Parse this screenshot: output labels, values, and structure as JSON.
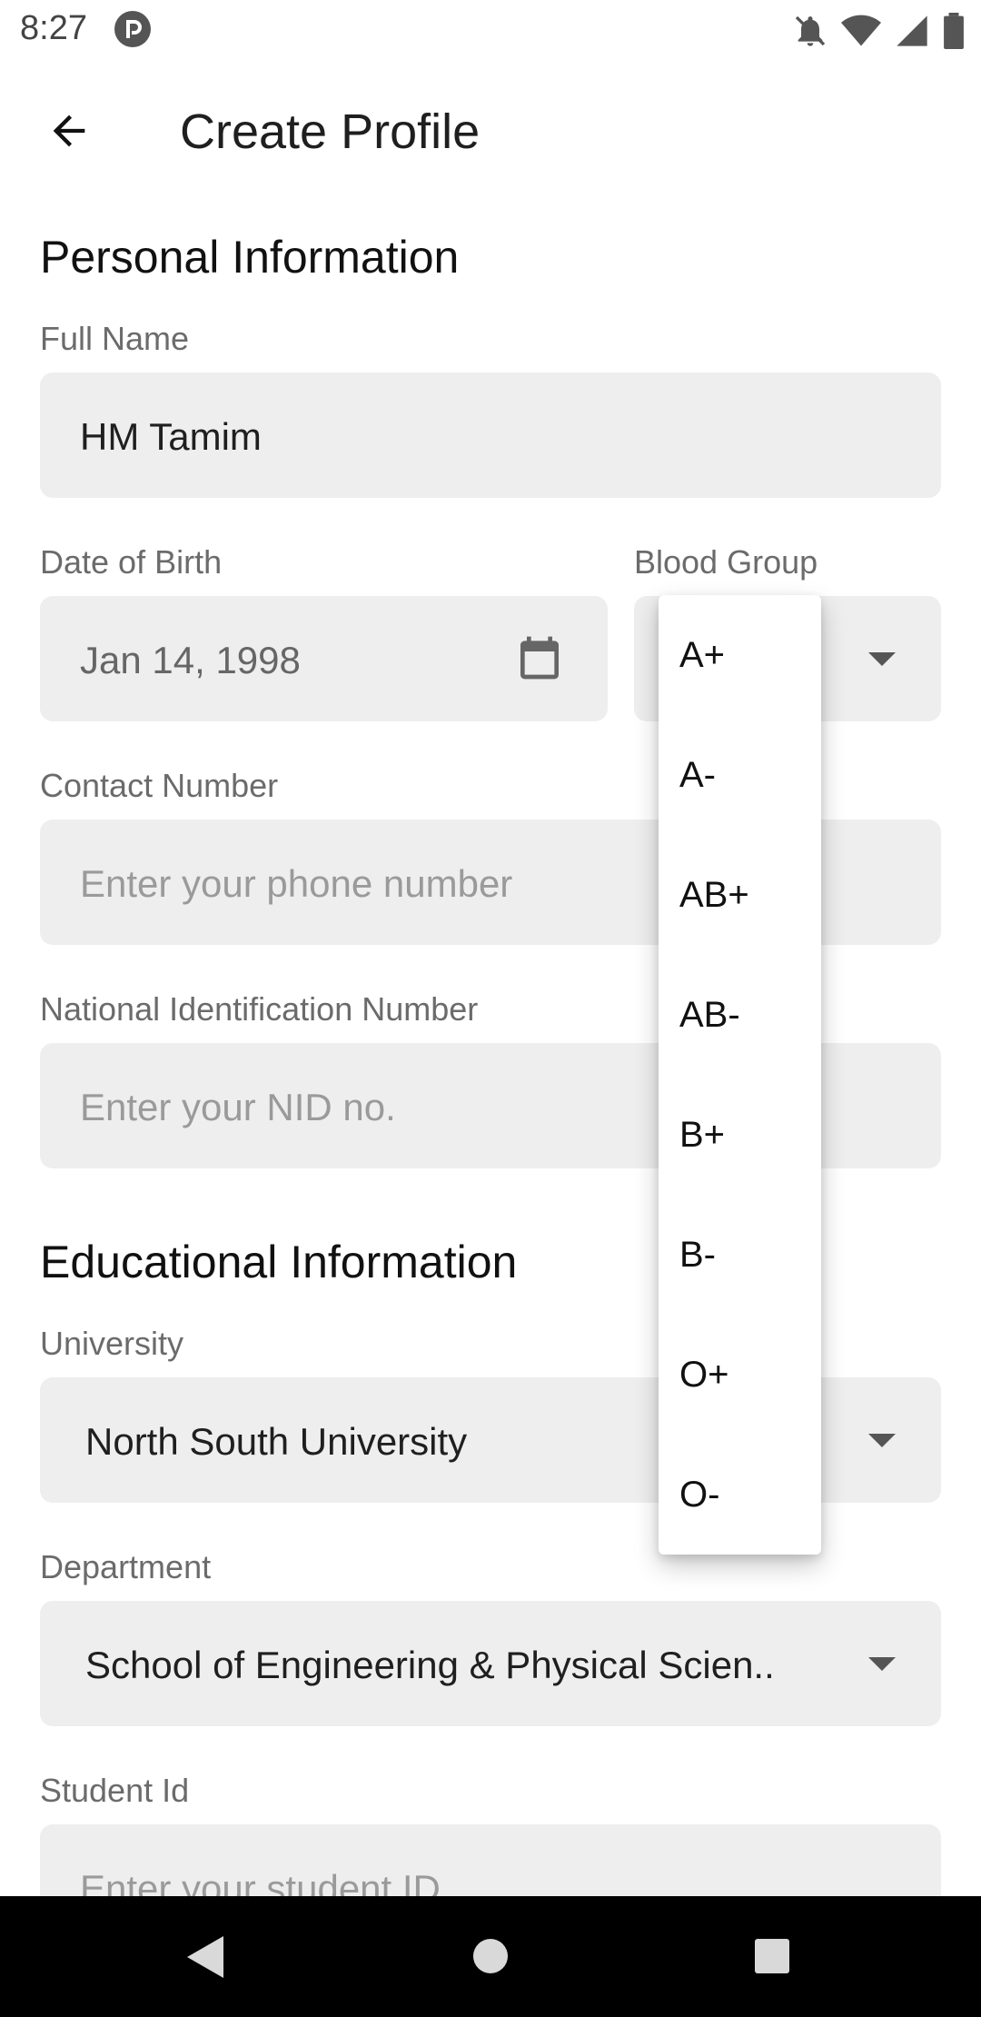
{
  "status_bar": {
    "time": "8:27",
    "icons": [
      "app-icon",
      "notifications-off-icon",
      "wifi-icon",
      "signal-icon",
      "battery-icon"
    ]
  },
  "app_bar": {
    "title": "Create Profile",
    "back_icon": "arrow-back-icon"
  },
  "personal": {
    "title": "Personal Information",
    "full_name": {
      "label": "Full Name",
      "value": "HM Tamim"
    },
    "dob": {
      "label": "Date of Birth",
      "value": "Jan 14, 1998",
      "icon": "calendar-icon"
    },
    "blood_group": {
      "label": "Blood Group",
      "value": ""
    },
    "contact": {
      "label": "Contact Number",
      "placeholder": "Enter your phone number"
    },
    "nid": {
      "label": "National Identification Number",
      "placeholder": "Enter your NID no."
    }
  },
  "education": {
    "title": "Educational Information",
    "university": {
      "label": "University",
      "value": "North South University"
    },
    "department": {
      "label": "Department",
      "value": "School of Engineering & Physical Scien.."
    },
    "student_id": {
      "label": "Student Id",
      "placeholder": "Enter your student ID"
    }
  },
  "blood_menu": {
    "options": [
      "A+",
      "A-",
      "AB+",
      "AB-",
      "B+",
      "B-",
      "O+",
      "O-"
    ]
  },
  "nav_bar": {
    "icons": [
      "back-triangle-icon",
      "home-circle-icon",
      "recents-square-icon"
    ]
  }
}
